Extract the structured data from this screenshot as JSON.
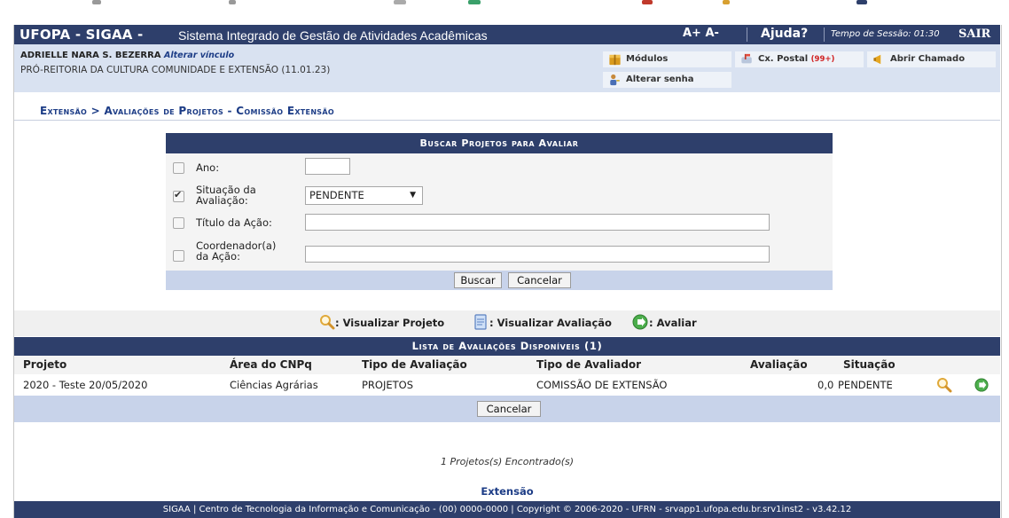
{
  "colors": {
    "brand": "#2e3f6b",
    "light": "#d9e2f1",
    "footer_band": "#c8d3ea",
    "link": "#1c3c86"
  },
  "header": {
    "logo": "UFOPA - SIGAA -",
    "system_name": "Sistema Integrado de Gestão de Atividades Acadêmicas",
    "font_size": "A+ A-",
    "help": "Ajuda?",
    "session": "Tempo de Sessão: 01:30",
    "logout": "SAIR"
  },
  "user": {
    "name": "ADRIELLE NARA S. BEZERRA",
    "change_link": "Alterar vínculo",
    "unit": "PRÓ-REITORIA DA CULTURA COMUNIDADE E EXTENSÃO (11.01.23)"
  },
  "quick_links": {
    "modules": "Módulos",
    "mailbox": "Cx. Postal",
    "mailbox_count": "(99+)",
    "ticket": "Abrir Chamado",
    "password": "Alterar senha"
  },
  "breadcrumb": "Extensão > Avaliações de Projetos - Comissão Extensão",
  "search_form": {
    "title": "Buscar Projetos para Avaliar",
    "year_label": "Ano:",
    "year_value": "",
    "status_label": "Situação da Avaliação:",
    "status_value": "PENDENTE",
    "title_label": "Título da Ação:",
    "coordinator_label": "Coordenador(a) da Ação:",
    "search_button": "Buscar",
    "cancel_button": "Cancelar"
  },
  "legend": {
    "view_project": ": Visualizar Projeto",
    "view_evaluation": ": Visualizar Avaliação",
    "evaluate": ": Avaliar"
  },
  "list": {
    "title": "Lista de Avaliações Disponíveis (1)",
    "columns": [
      "Projeto",
      "Área do CNPq",
      "Tipo de Avaliação",
      "Tipo de Avaliador",
      "Avaliação",
      "Situação"
    ],
    "rows": [
      {
        "project": "2020 - Teste 20/05/2020",
        "area": "Ciências Agrárias",
        "type": "PROJETOS",
        "evaluator": "COMISSÃO DE EXTENSÃO",
        "score": "0,0",
        "status": "PENDENTE"
      }
    ],
    "cancel_button": "Cancelar"
  },
  "found_text": "1 Projetos(s) Encontrado(s)",
  "module_link": "Extensão",
  "footer": "SIGAA | Centro de Tecnologia da Informação e Comunicação - (00) 0000-0000 | Copyright © 2006-2020 - UFRN - srvapp1.ufopa.edu.br.srv1inst2 - v3.42.12"
}
